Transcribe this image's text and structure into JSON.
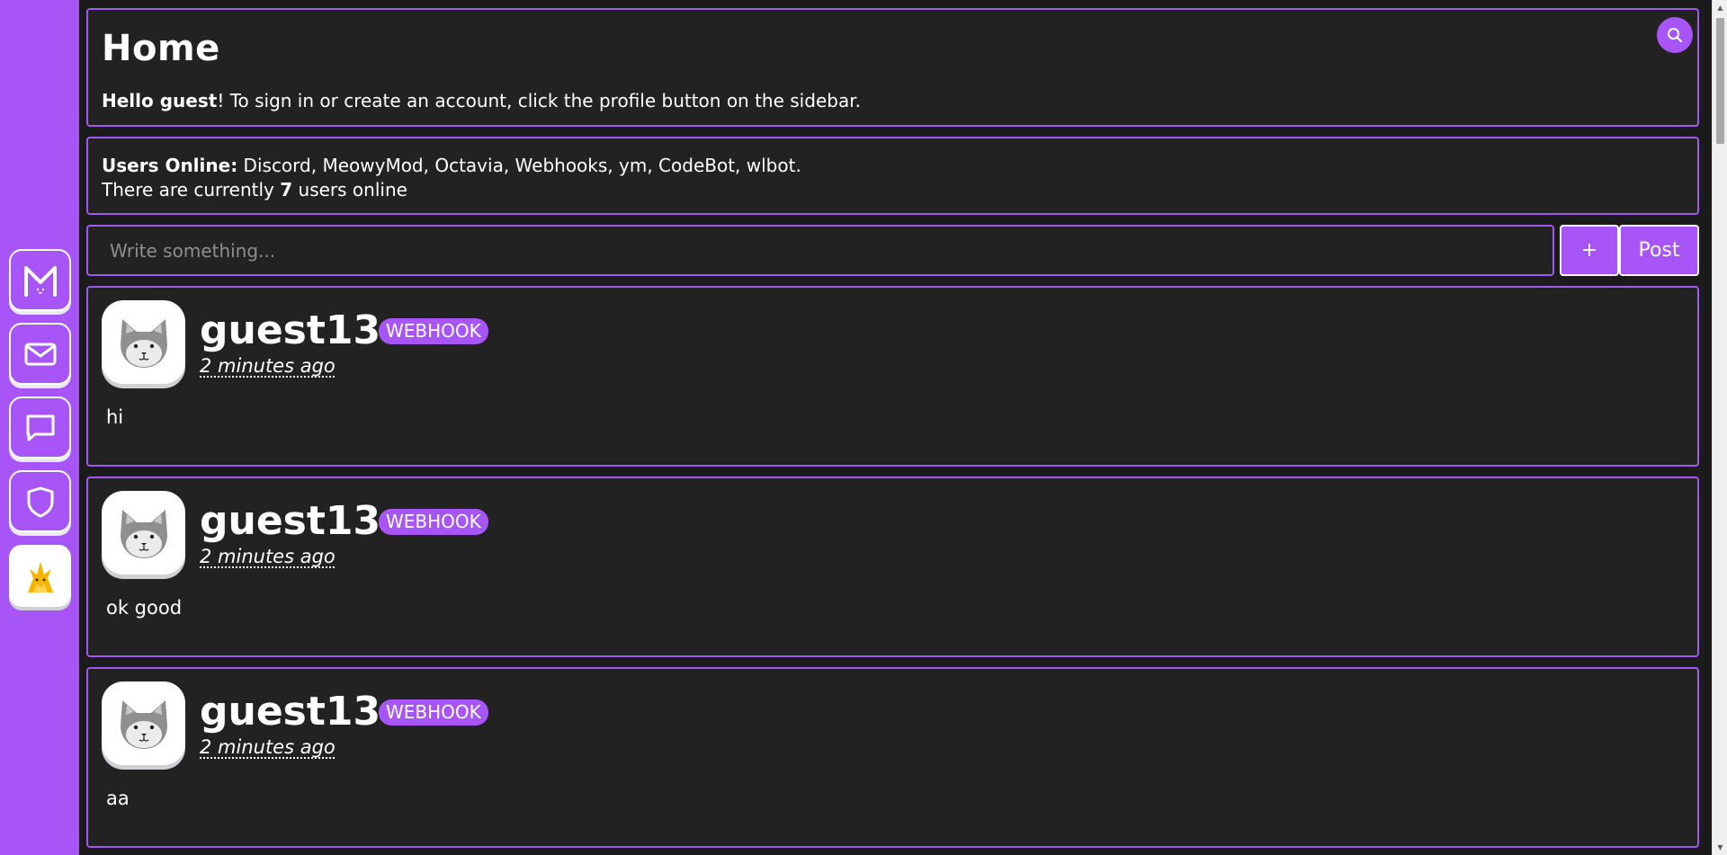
{
  "sidebar": {
    "items": [
      {
        "name": "meower-logo",
        "icon": "m-logo-icon"
      },
      {
        "name": "inbox",
        "icon": "mail-icon"
      },
      {
        "name": "chats",
        "icon": "chat-bubble-icon"
      },
      {
        "name": "moderation",
        "icon": "shield-icon"
      },
      {
        "name": "profile",
        "icon": "avatar-icon"
      }
    ]
  },
  "header": {
    "title": "Home",
    "greeting_bold": "Hello guest",
    "greeting_rest": "! To sign in or create an account, click the profile button on the sidebar.",
    "search_icon": "search-icon"
  },
  "online": {
    "label": "Users Online:",
    "users": " Discord, MeowyMod, Octavia, Webhooks, ym, CodeBot, wlbot.",
    "count_prefix": "There are currently ",
    "count": "7",
    "count_suffix": " users online"
  },
  "composer": {
    "placeholder": "Write something...",
    "plus_label": "+",
    "post_label": "Post"
  },
  "posts": [
    {
      "author": "guest13",
      "badge": "WEBHOOK",
      "time": "2 minutes ago",
      "body": "hi"
    },
    {
      "author": "guest13",
      "badge": "WEBHOOK",
      "time": "2 minutes ago",
      "body": "ok good"
    },
    {
      "author": "guest13",
      "badge": "WEBHOOK",
      "time": "2 minutes ago",
      "body": "aa"
    }
  ],
  "colors": {
    "accent": "#a855f7",
    "background": "#1b1b1b",
    "panel": "#222222",
    "panel_border": "#9f59f0"
  }
}
